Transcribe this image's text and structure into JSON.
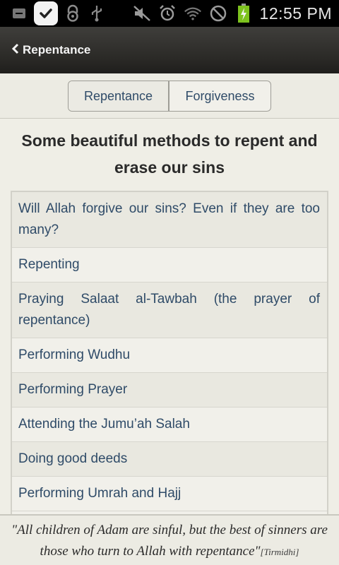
{
  "status_bar": {
    "time": "12:55 PM",
    "icons": [
      "notification-icon",
      "check-icon",
      "lock-icon",
      "usb-icon",
      "mute-icon",
      "alarm-icon",
      "wifi-icon",
      "no-signal-icon",
      "battery-charging-icon"
    ]
  },
  "header": {
    "back_label": "Repentance"
  },
  "tabs": [
    {
      "label": "Repentance",
      "selected": true
    },
    {
      "label": "Forgiveness",
      "selected": false
    }
  ],
  "main": {
    "title": "Some beautiful methods to repent and erase our sins",
    "items": [
      "Will Allah forgive our sins? Even if they are too many?",
      "Repenting",
      "Praying Salaat al-Tawbah (the prayer of repentance)",
      "Performing Wudhu",
      "Performing Prayer",
      "Attending the Jumu’ah Salah",
      "Doing good deeds",
      "Performing Umrah and Hajj"
    ]
  },
  "footer": {
    "quote": "\"All children of Adam are sinful, but the best of sinners are those who turn to Allah with repentance\"",
    "source": "[Tirmidhi]"
  },
  "colors": {
    "link_text": "#2f4b68",
    "background": "#efeee6",
    "header_bg": "#2a2926"
  }
}
